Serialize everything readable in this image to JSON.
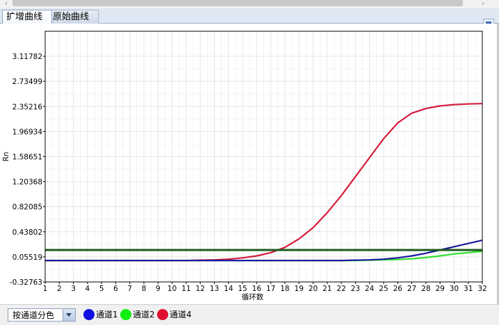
{
  "tabs": [
    {
      "label": "扩增曲线",
      "active": true
    },
    {
      "label": "原始曲线",
      "active": false
    }
  ],
  "bottom_bar": {
    "color_mode": "按通道分色",
    "legend": [
      {
        "label": "通道1",
        "color": "#1010e0"
      },
      {
        "label": "通道2",
        "color": "#10f010"
      },
      {
        "label": "通道4",
        "color": "#e01030"
      }
    ]
  },
  "colors": {
    "threshold": "#1d5a1d",
    "channel1": "#1a1aa0",
    "channel2": "#30e030",
    "channel4": "#d41c3c",
    "tab_strip": "#dfe7f2"
  },
  "icons": {
    "scroll_left": "chevron-left-icon",
    "scroll_right": "chevron-right-icon",
    "pin": "pin-corner-icon",
    "dropdown": "chevron-down-icon"
  },
  "chart_data": {
    "type": "line",
    "xlabel": "循环数",
    "ylabel": "Rn",
    "ylim": [
      -0.32763,
      3.5
    ],
    "xlim": [
      1,
      32
    ],
    "grid": true,
    "x_ticks": [
      "1",
      "2",
      "3",
      "4",
      "5",
      "6",
      "7",
      "8",
      "9",
      "10",
      "11",
      "12",
      "13",
      "14",
      "15",
      "16",
      "17",
      "18",
      "19",
      "20",
      "21",
      "22",
      "23",
      "24",
      "25",
      "26",
      "27",
      "28",
      "29",
      "30",
      "31",
      "32"
    ],
    "y_ticks": [
      "-0.32763",
      "0.05519",
      "0.43802",
      "0.82085",
      "1.20368",
      "1.58651",
      "1.96934",
      "2.35216",
      "2.73499",
      "3.11782"
    ],
    "y_tick_values": [
      -0.32763,
      0.05519,
      0.43802,
      0.82085,
      1.20368,
      1.58651,
      1.96934,
      2.35216,
      2.73499,
      3.11782
    ],
    "threshold": 0.16,
    "x": [
      1,
      2,
      3,
      4,
      5,
      6,
      7,
      8,
      9,
      10,
      11,
      12,
      13,
      14,
      15,
      16,
      17,
      18,
      19,
      20,
      21,
      22,
      23,
      24,
      25,
      26,
      27,
      28,
      29,
      30,
      31,
      32
    ],
    "series": [
      {
        "name": "通道4",
        "color": "#d41c3c",
        "values": [
          0.0,
          0.0,
          0.0,
          0.0,
          0.0,
          0.0,
          0.0,
          0.0,
          0.0,
          0.0,
          0.0,
          0.005,
          0.01,
          0.02,
          0.04,
          0.07,
          0.12,
          0.2,
          0.33,
          0.5,
          0.73,
          0.99,
          1.28,
          1.57,
          1.86,
          2.1,
          2.25,
          2.32,
          2.36,
          2.38,
          2.39,
          2.395
        ]
      },
      {
        "name": "通道1",
        "color": "#1a1aa0",
        "values": [
          0.0,
          0.0,
          0.0,
          0.0,
          0.0,
          0.0,
          0.0,
          0.0,
          0.0,
          0.0,
          0.0,
          0.0,
          0.0,
          0.0,
          0.0,
          0.0,
          0.0,
          0.0,
          0.0,
          0.0,
          0.0,
          0.0,
          0.005,
          0.01,
          0.02,
          0.04,
          0.07,
          0.11,
          0.16,
          0.21,
          0.26,
          0.31
        ]
      },
      {
        "name": "通道2",
        "color": "#30e030",
        "values": [
          0.0,
          0.0,
          0.0,
          0.0,
          0.0,
          0.0,
          0.0,
          0.0,
          0.0,
          0.0,
          0.0,
          0.0,
          0.0,
          0.0,
          0.0,
          0.0,
          0.0,
          0.0,
          0.0,
          0.0,
          0.0,
          0.0,
          0.0,
          0.005,
          0.01,
          0.015,
          0.025,
          0.045,
          0.07,
          0.1,
          0.12,
          0.14
        ]
      }
    ]
  }
}
